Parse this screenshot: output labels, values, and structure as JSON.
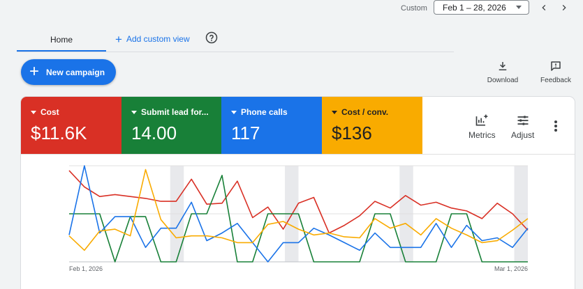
{
  "date_range": {
    "label": "Custom",
    "value": "Feb 1 – 28, 2026"
  },
  "tabs": {
    "home": "Home",
    "add_custom_view": "Add custom view"
  },
  "actions": {
    "new_campaign": "New campaign",
    "download": "Download",
    "feedback": "Feedback"
  },
  "metrics": [
    {
      "name": "Cost",
      "value": "$11.6K",
      "color": "#d93025"
    },
    {
      "name": "Submit lead for...",
      "value": "14.00",
      "color": "#188038"
    },
    {
      "name": "Phone calls",
      "value": "117",
      "color": "#1a73e8"
    },
    {
      "name": "Cost / conv.",
      "value": "$136",
      "color": "#f9ab00"
    }
  ],
  "chart_tools": {
    "metrics": "Metrics",
    "adjust": "Adjust"
  },
  "chart_data": {
    "type": "line",
    "x_start_label": "Feb 1, 2026",
    "x_end_label": "Mar 1, 2026",
    "x_count": 29,
    "weekend_bands": [
      6,
      13,
      20,
      27
    ],
    "series": [
      {
        "color": "#d93025",
        "values": [
          0.95,
          0.78,
          0.68,
          0.7,
          0.68,
          0.66,
          0.63,
          0.63,
          0.86,
          0.6,
          0.61,
          0.84,
          0.46,
          0.57,
          0.34,
          0.61,
          0.67,
          0.3,
          0.38,
          0.48,
          0.63,
          0.56,
          0.69,
          0.59,
          0.62,
          0.56,
          0.53,
          0.45,
          0.61,
          0.5,
          0.33
        ]
      },
      {
        "color": "#188038",
        "values": [
          0.5,
          0.5,
          0.5,
          0.0,
          0.47,
          0.47,
          0.0,
          0.0,
          0.5,
          0.5,
          0.9,
          0.0,
          0.0,
          0.5,
          0.5,
          0.5,
          0.0,
          0.0,
          0.0,
          0.0,
          0.5,
          0.5,
          0.0,
          0.0,
          0.0,
          0.5,
          0.5,
          0.0,
          0.0,
          0.0,
          0.0
        ]
      },
      {
        "color": "#1a73e8",
        "values": [
          0.28,
          1.0,
          0.3,
          0.47,
          0.47,
          0.15,
          0.35,
          0.35,
          0.62,
          0.22,
          0.3,
          0.4,
          0.2,
          0.0,
          0.2,
          0.2,
          0.35,
          0.28,
          0.2,
          0.12,
          0.3,
          0.15,
          0.15,
          0.15,
          0.4,
          0.15,
          0.38,
          0.22,
          0.25,
          0.15,
          0.35
        ]
      },
      {
        "color": "#f9ab00",
        "values": [
          0.27,
          0.12,
          0.32,
          0.34,
          0.27,
          0.96,
          0.44,
          0.25,
          0.27,
          0.27,
          0.25,
          0.2,
          0.2,
          0.39,
          0.42,
          0.34,
          0.28,
          0.3,
          0.26,
          0.25,
          0.45,
          0.35,
          0.4,
          0.28,
          0.45,
          0.35,
          0.28,
          0.2,
          0.22,
          0.33,
          0.45
        ]
      }
    ]
  }
}
